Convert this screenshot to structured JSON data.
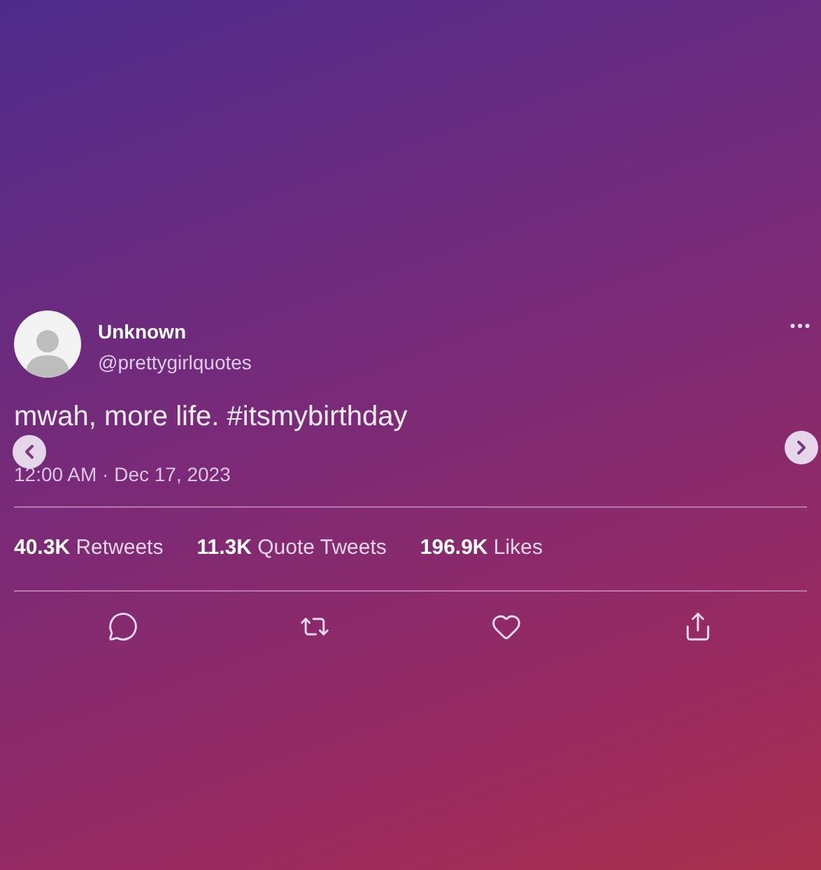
{
  "tweet": {
    "author": {
      "name": "Unknown",
      "handle": "@prettygirlquotes"
    },
    "text": "mwah, more life. #itsmybirthday",
    "timestamp": "12:00 AM · Dec 17, 2023",
    "stats": [
      "**40.3K** Retweets",
      "**11.3K** Quote Tweets",
      "**196.9K** Likes"
    ],
    "actions": [
      {
        "kind": "reply"
      },
      {
        "kind": "retweet"
      },
      {
        "kind": "like"
      },
      {
        "kind": "share"
      }
    ]
  },
  "carousel": {
    "has_previous": true,
    "has_next": true
  }
}
